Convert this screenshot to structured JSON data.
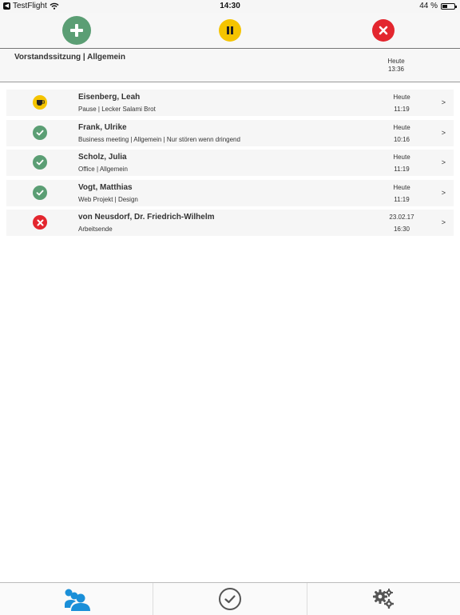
{
  "status_bar": {
    "app_back_label": "TestFlight",
    "time": "14:30",
    "battery_text": "44 %",
    "battery_level": 0.44
  },
  "header": {
    "actions": {
      "add_icon": "plus-icon",
      "pause_icon": "pause-icon",
      "stop_icon": "close-icon"
    },
    "current": {
      "title": "Vorstandssitzung | Allgemein",
      "day": "Heute",
      "time": "13:36"
    }
  },
  "list": {
    "rows": [
      {
        "name": "Eisenberg, Leah",
        "subtitle": "Pause | Lecker Salami Brot",
        "day": "Heute",
        "time": "11:19",
        "status": "pause",
        "chevron": ">"
      },
      {
        "name": "Frank, Ulrike",
        "subtitle": "Business meeting  | Allgemein | Nur stören wenn dringend",
        "day": "Heute",
        "time": "10:16",
        "status": "done",
        "chevron": ">"
      },
      {
        "name": "Scholz, Julia",
        "subtitle": "Office | Allgemein",
        "day": "Heute",
        "time": "11:19",
        "status": "done",
        "chevron": ">"
      },
      {
        "name": "Vogt, Matthias",
        "subtitle": "Web Projekt | Design",
        "day": "Heute",
        "time": "11:19",
        "status": "done",
        "chevron": ">"
      },
      {
        "name": "von Neusdorf, Dr. Friedrich-Wilhelm",
        "subtitle": "Arbeitsende",
        "day": "23.02.17",
        "time": "16:30",
        "status": "stop",
        "chevron": ">"
      }
    ]
  },
  "tabbar": {
    "tabs": [
      {
        "icon": "people-icon",
        "active": true
      },
      {
        "icon": "check-circle-icon",
        "active": false
      },
      {
        "icon": "gears-icon",
        "active": false
      }
    ]
  },
  "colors": {
    "green": "#5b9e74",
    "yellow": "#f5c400",
    "red": "#e3262e",
    "active_tab_blue": "#1a8fd8",
    "inactive_tab_gray": "#555555"
  }
}
